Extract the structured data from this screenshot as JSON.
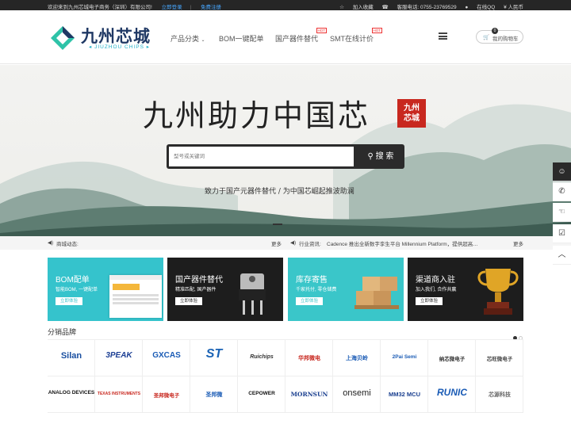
{
  "topbar": {
    "welcome": "欢迎来到九州芯城电子商务（深圳）有限公司!",
    "login": "立即登录",
    "register": "免费注册",
    "favorite": "加入收藏",
    "service": "客服电话: 0755-23769529",
    "qq": "在线QQ",
    "currency": "¥ 人民币"
  },
  "logo": {
    "title": "九州芯城",
    "subtitle": "JIUZHOU CHIPS"
  },
  "nav": {
    "categories": "产品分类",
    "bom": "BOM一键配单",
    "domestic": "国产器件替代",
    "smt": "SMT在线计价",
    "hot": "HOT",
    "cart": "我的购物车",
    "cart_count": "0"
  },
  "banner": {
    "slogan": "九州助力中国芯",
    "seal": [
      "九州",
      "芯城"
    ],
    "search_placeholder": "型号或关键词",
    "search_button": "搜 索",
    "tagline": "致力于国产元器件替代 / 为中国芯崛起推波助澜"
  },
  "news": {
    "label": "商城动态:",
    "more": "更多",
    "industry_label": "行业资讯:",
    "industry_item": "Cadence 推出全新数字孪生平台 Millennium Platform，提供超高性能和…",
    "more2": "更多"
  },
  "tiles": [
    {
      "title": "BOM配单",
      "sub": "智能BOM, 一键配单",
      "btn": "立即体验",
      "color": "#35c3cc"
    },
    {
      "title": "国产器件替代",
      "sub": "精准匹配, 国产器件",
      "btn": "立即体验",
      "color": "#1d1d1d"
    },
    {
      "title": "库存寄售",
      "sub": "千家托付, 零仓储费",
      "btn": "立即体验",
      "color": "#3ac6c9"
    },
    {
      "title": "渠道商入驻",
      "sub": "加入我们, 合作共赢",
      "btn": "立即体验",
      "color": "#1d1d1d"
    }
  ],
  "brands_title": "分销品牌",
  "brands": [
    {
      "name": "Silan",
      "color": "#1a4fa0"
    },
    {
      "name": "3PEAK",
      "color": "#1c3f94"
    },
    {
      "name": "GXCAS",
      "color": "#1a5bb5"
    },
    {
      "name": "ST",
      "color": "#1a63b5"
    },
    {
      "name": "Ruichips",
      "color": "#333333"
    },
    {
      "name": "华邦微电",
      "color": "#c8281f"
    },
    {
      "name": "上海贝岭",
      "color": "#1a5bb5"
    },
    {
      "name": "2Pai Semi",
      "color": "#1a5bb5"
    },
    {
      "name": "纳芯微电子",
      "color": "#333333"
    },
    {
      "name": "芯旺微电子",
      "color": "#444444"
    },
    {
      "name": "ANALOG DEVICES",
      "color": "#111111"
    },
    {
      "name": "TEXAS INSTRUMENTS",
      "color": "#c8281f"
    },
    {
      "name": "圣邦微电子",
      "color": "#c8281f"
    },
    {
      "name": "圣邦微",
      "color": "#1a5bb5"
    },
    {
      "name": "CEPOWER",
      "color": "#111111"
    },
    {
      "name": "MORNSUN",
      "color": "#1a3f8f"
    },
    {
      "name": "onsemi",
      "color": "#222222"
    },
    {
      "name": "MM32 MCU",
      "color": "#1a3f8f"
    },
    {
      "name": "RUNIC",
      "color": "#1a5bb5"
    },
    {
      "name": "芯源科技",
      "color": "#666666"
    }
  ]
}
